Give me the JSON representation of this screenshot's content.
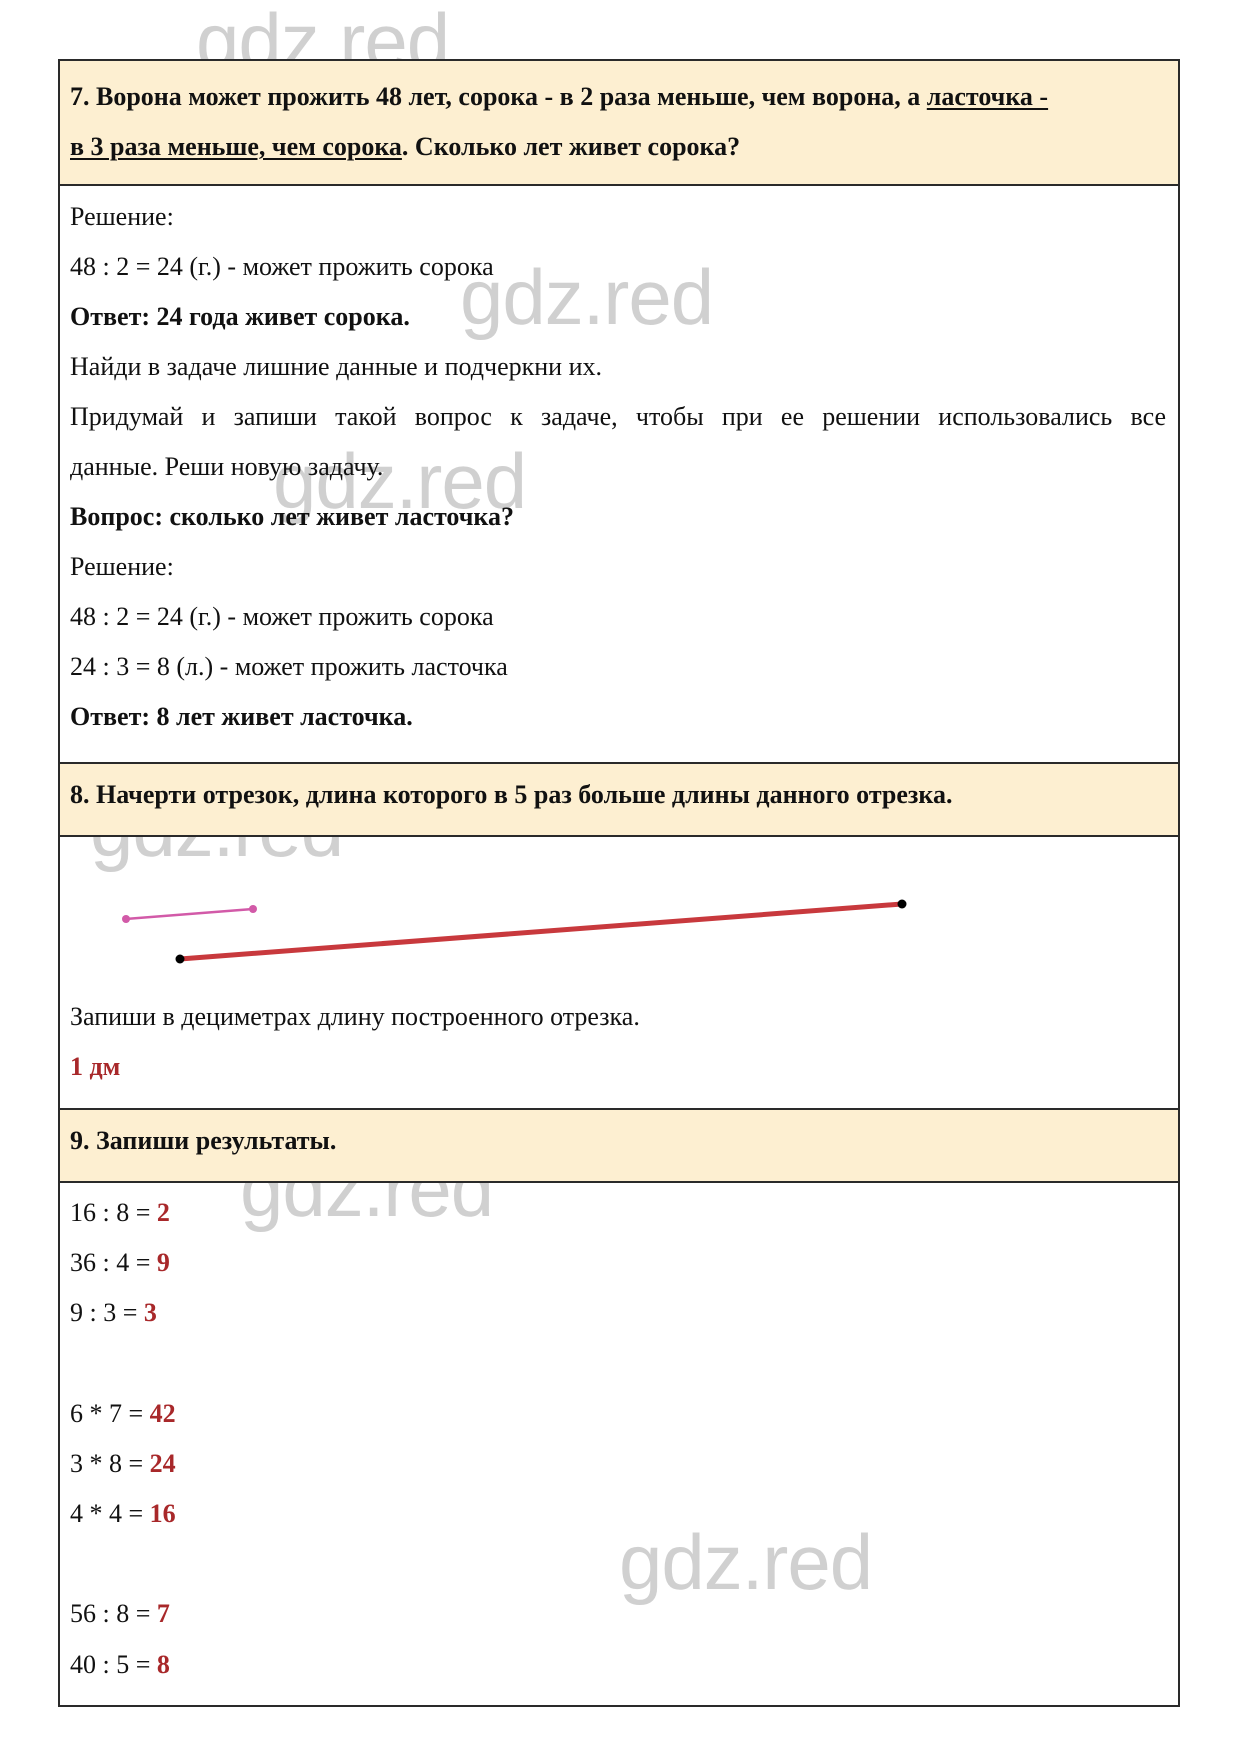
{
  "watermark": "gdz.red",
  "task7": {
    "question_parts": [
      {
        "text": "7. Ворона может прожить 48 лет, сорока - в 2 раза меньше, чем ворона, а ",
        "underline": false
      },
      {
        "text": "ласточка -",
        "underline": true
      }
    ],
    "question_line2_parts": [
      {
        "text": "в 3 раза меньше, чем сорока",
        "underline": true
      },
      {
        "text": ". Сколько лет живет сорока?",
        "underline": false
      }
    ],
    "solution_label": "Решение:",
    "step1": "48 : 2 = 24 (г.) - может прожить сорока",
    "answer": "Ответ: 24 года живет сорока.",
    "instruction1": "Найди в задаче лишние данные и подчеркни их.",
    "instruction2_line1": "Придумай и запиши такой вопрос к задаче, чтобы при ее решении использовались все",
    "instruction2_line2": "данные. Реши новую задачу.",
    "new_question": "Вопрос: сколько лет живет ласточка?",
    "solution2_label": "Решение:",
    "solution2_step1": "48 : 2 = 24 (г.) - может прожить сорока",
    "solution2_step2": "24 : 3 = 8 (л.) - может прожить ласточка",
    "answer2": "Ответ: 8 лет живет ласточка."
  },
  "task8": {
    "question": "8. Начерти отрезок, длина которого в 5 раз больше длины данного отрезка.",
    "given_segment_color": "#d25aa8",
    "drawn_segment_color": "#c8393d",
    "length_ratio": 5,
    "instruction": "Запиши в дециметрах длину построенного отрезка.",
    "answer": "1 дм"
  },
  "task9": {
    "question": "9. Запиши результаты.",
    "groups": [
      [
        {
          "expr": "16 : 8 = ",
          "result": "2"
        },
        {
          "expr": "36 : 4 = ",
          "result": "9"
        },
        {
          "expr": "9 : 3 = ",
          "result": "3"
        }
      ],
      [
        {
          "expr": "6 * 7 = ",
          "result": "42"
        },
        {
          "expr": "3 * 8 = ",
          "result": "24"
        },
        {
          "expr": "4 * 4 = ",
          "result": "16"
        }
      ],
      [
        {
          "expr": "56 : 8 = ",
          "result": "7"
        },
        {
          "expr": "40 : 5 = ",
          "result": "8"
        }
      ]
    ]
  },
  "colors": {
    "header_bg": "#fdefd1",
    "answer_red": "#a8282a",
    "border": "#2a2a2a"
  }
}
